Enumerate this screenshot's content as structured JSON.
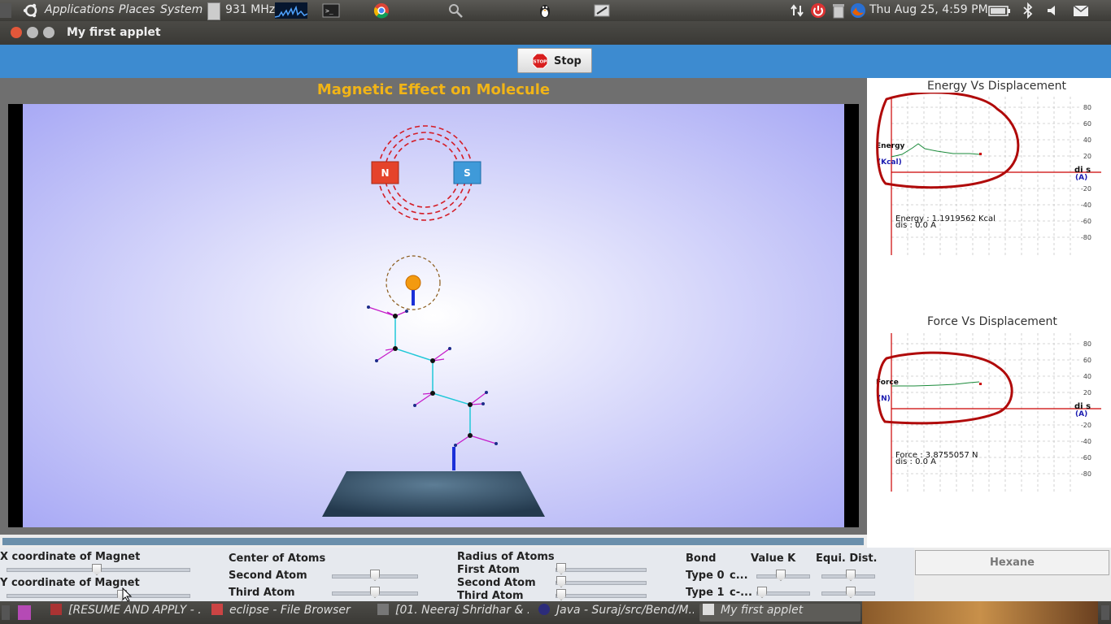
{
  "top_panel": {
    "menu": [
      "Applications",
      "Places",
      "System"
    ],
    "cpu_freq": "931 MHz",
    "clock": "Thu Aug 25,  4:59 PM"
  },
  "window": {
    "title": "My first applet"
  },
  "toolbar": {
    "stop_label": "Stop",
    "stop_icon_text": "STOP"
  },
  "simulation": {
    "title": "Magnetic Effect on Molecule",
    "magnet": {
      "north_label": "N",
      "south_label": "S"
    }
  },
  "graphs": {
    "energy": {
      "title": "Energy Vs Displacement",
      "y_label": "Energy",
      "y_unit": "(Kcal)",
      "x_label": "di s",
      "x_unit": "(A)",
      "ticks": [
        "80",
        "60",
        "40",
        "20",
        "0",
        "-20",
        "-40",
        "-60",
        "-80"
      ],
      "readout_value": "Energy : 1.1919562 Kcal",
      "readout_dis": "dis : 0.0 A"
    },
    "force": {
      "title": "Force Vs Displacement",
      "y_label": "Force",
      "y_unit": "(N)",
      "x_label": "di s",
      "x_unit": "(A)",
      "ticks": [
        "80",
        "60",
        "40",
        "20",
        "0",
        "-20",
        "-40",
        "-60",
        "-80"
      ],
      "readout_value": "Force : 3.8755057 N",
      "readout_dis": "dis : 0.0 A"
    }
  },
  "controls": {
    "x_magnet_label": "X coordinate of Magnet",
    "y_magnet_label": "Y coordinate of Magnet",
    "center_atoms_label": "Center of Atoms",
    "second_atom_label": "Second Atom",
    "third_atom_label": "Third Atom",
    "radius_atoms_label": "Radius of Atoms",
    "first_atom_label": "First Atom",
    "radius_second_label": "Second Atom",
    "radius_third_label": "Third Atom",
    "bond_label": "Bond",
    "value_k_label": "Value K",
    "equi_dist_label": "Equi. Dist.",
    "type0_label": "Type 0",
    "type0_value": "c...",
    "type1_label": "Type 1",
    "type1_value": "c-...",
    "hexane_label": "Hexane"
  },
  "taskbar": {
    "items": [
      "[RESUME AND APPLY - ...",
      "eclipse - File Browser",
      "[01. Neeraj Shridhar & ...",
      "Java - Suraj/src/Bend/M...",
      "My first applet"
    ]
  }
}
